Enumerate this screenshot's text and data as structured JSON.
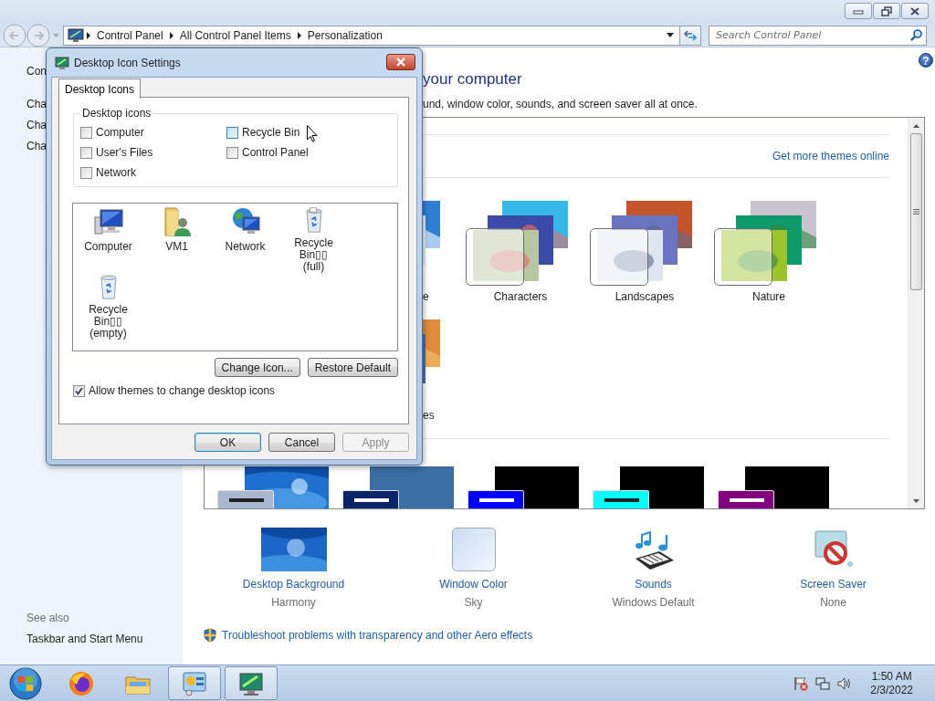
{
  "address_bar": {
    "crumbs": [
      "Control Panel",
      "All Control Panel Items",
      "Personalization"
    ]
  },
  "search": {
    "placeholder": "Search Control Panel"
  },
  "sidebar": {
    "items": [
      "Con",
      "Cha",
      "Cha",
      "Cha"
    ],
    "see_also_title": "See also",
    "see_also": [
      "Taskbar and Start Menu"
    ]
  },
  "main": {
    "help": "?",
    "heading": "your computer",
    "subtitle": "und, window color, sounds, and screen saver all at once.",
    "themes_link": "Get more themes online",
    "theme_rows": [
      [
        {
          "name": "e",
          "kind": "picture"
        },
        {
          "name": "Characters",
          "kind": "picture"
        },
        {
          "name": "Landscapes",
          "kind": "picture"
        },
        {
          "name": "Nature",
          "kind": "picture"
        }
      ],
      [
        {
          "name": "es",
          "kind": "picture"
        }
      ]
    ],
    "basic_themes": [
      {
        "kind": "picture",
        "window": {
          "color": "#a9b8cf"
        }
      },
      {
        "kind": "solid",
        "color": "#3a6ea5",
        "window": {
          "color": "#0a246a"
        }
      },
      {
        "kind": "solid",
        "color": "#000000",
        "window": {
          "color": "#0000ff"
        }
      },
      {
        "kind": "solid",
        "color": "#000000",
        "window": {
          "color": "#00ffff"
        }
      },
      {
        "kind": "solid",
        "color": "#000000",
        "window": {
          "color": "#800080"
        }
      }
    ],
    "personalize": [
      {
        "label": "Desktop Background",
        "value": "Harmony",
        "kind": "wallpaper"
      },
      {
        "label": "Window Color",
        "value": "Sky",
        "kind": "swatch"
      },
      {
        "label": "Sounds",
        "value": "Windows Default",
        "kind": "sounds"
      },
      {
        "label": "Screen Saver",
        "value": "None",
        "kind": "screensaver"
      }
    ],
    "troubleshoot": "Troubleshoot problems with transparency and other Aero effects"
  },
  "dialog": {
    "title": "Desktop Icon Settings",
    "tabs": [
      {
        "label": "Desktop Icons",
        "selected": true
      }
    ],
    "group_title": "Desktop icons",
    "checkboxes": [
      {
        "label": "Computer",
        "checked": false,
        "hovered": false
      },
      {
        "label": "Recycle Bin",
        "checked": false,
        "hovered": true
      },
      {
        "label": "User's Files",
        "checked": false,
        "hovered": false
      },
      {
        "label": "Control Panel",
        "checked": false,
        "hovered": false
      },
      {
        "label": "Network",
        "checked": false,
        "hovered": false
      }
    ],
    "icons": [
      {
        "label": "Computer",
        "kind": "computer"
      },
      {
        "label": "VM1",
        "kind": "user-folder"
      },
      {
        "label": "Network",
        "kind": "network"
      },
      {
        "label": "Recycle Bin▯▯\n(full)",
        "kind": "trash-full"
      },
      {
        "label": "Recycle Bin▯▯\n(empty)",
        "kind": "trash-empty"
      }
    ],
    "icon_buttons": [
      "Change Icon...",
      "Restore Default"
    ],
    "allow_themes": {
      "label": "Allow themes to change desktop icons",
      "checked": true
    },
    "footer_buttons": [
      {
        "label": "OK",
        "default": true,
        "disabled": false
      },
      {
        "label": "Cancel",
        "default": false,
        "disabled": false
      },
      {
        "label": "Apply",
        "default": false,
        "disabled": true
      }
    ]
  },
  "taskbar": {
    "items": [
      {
        "kind": "browser",
        "active": false
      },
      {
        "kind": "explorer",
        "active": false
      },
      {
        "kind": "control-panel",
        "active": true
      },
      {
        "kind": "display",
        "active": true
      }
    ],
    "time": "1:50 AM",
    "date": "2/3/2022"
  }
}
